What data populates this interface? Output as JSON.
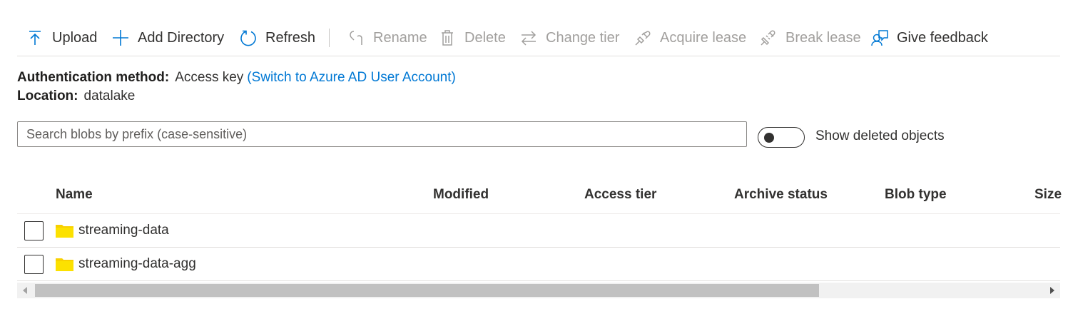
{
  "toolbar": {
    "upload": "Upload",
    "add_directory": "Add Directory",
    "refresh": "Refresh",
    "rename": "Rename",
    "delete": "Delete",
    "change_tier": "Change tier",
    "acquire_lease": "Acquire lease",
    "break_lease": "Break lease",
    "give_feedback": "Give feedback"
  },
  "info": {
    "auth_label": "Authentication method:",
    "auth_value": "Access key",
    "auth_link": "(Switch to Azure AD User Account)",
    "location_label": "Location:",
    "location_value": "datalake"
  },
  "search": {
    "placeholder": "Search blobs by prefix (case-sensitive)",
    "value": ""
  },
  "show_deleted": {
    "label": "Show deleted objects",
    "on": false
  },
  "table": {
    "columns": [
      "Name",
      "Modified",
      "Access tier",
      "Archive status",
      "Blob type",
      "Size"
    ],
    "rows": [
      {
        "name": "streaming-data",
        "type": "folder"
      },
      {
        "name": "streaming-data-agg",
        "type": "folder"
      }
    ]
  },
  "colors": {
    "accent": "#0078d4",
    "folder": "#f8d000",
    "disabled_text": "#a19f9d",
    "text": "#323130"
  }
}
